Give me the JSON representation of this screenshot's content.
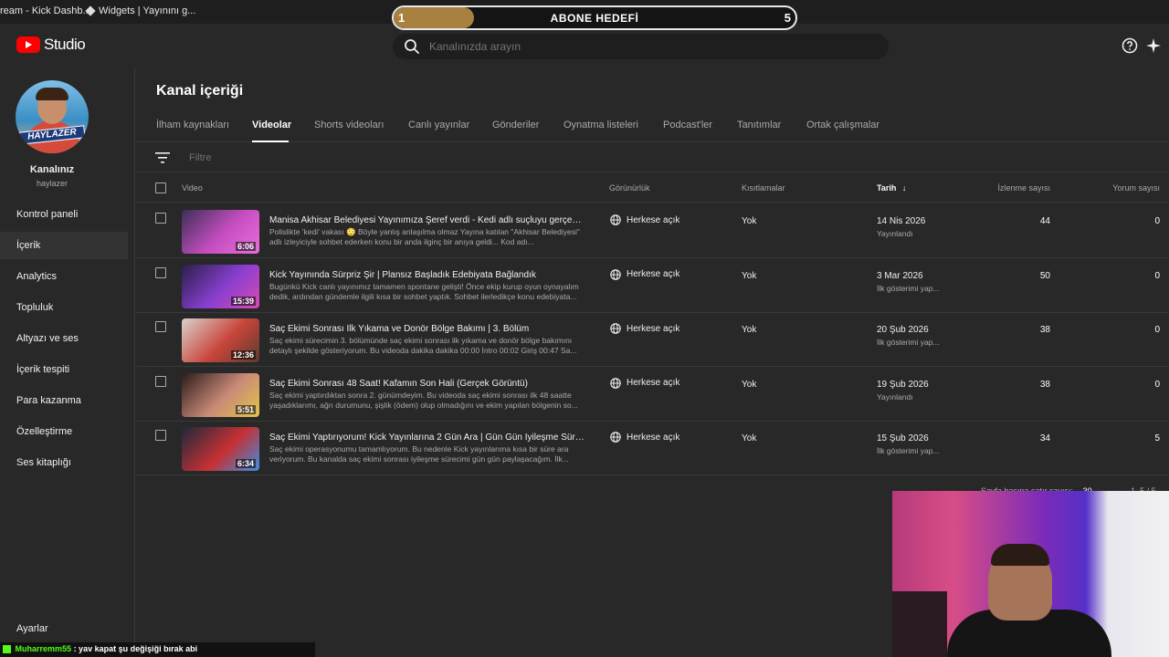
{
  "browser_tabs": [
    {
      "label": "ream - Kick Dashb...",
      "icon": "kick-icon"
    },
    {
      "label": "Widgets | Yayınını g...",
      "icon": "diamond-icon"
    }
  ],
  "goal_overlay": {
    "title": "ABONE HEDEFİ",
    "current": "1",
    "target": "5",
    "progress": 0.2,
    "fill_color": "#a8803f"
  },
  "header": {
    "logo_text": "Studio",
    "search_placeholder": "Kanalınızda arayın"
  },
  "sidebar": {
    "channel_name": "Kanalınız",
    "channel_handle": "haylazer",
    "avatar_text": "HAYLAZER",
    "items": [
      {
        "label": "Kontrol paneli",
        "active": false
      },
      {
        "label": "İçerik",
        "active": true
      },
      {
        "label": "Analytics",
        "active": false
      },
      {
        "label": "Topluluk",
        "active": false
      },
      {
        "label": "Altyazı ve ses",
        "active": false
      },
      {
        "label": "İçerik tespiti",
        "active": false
      },
      {
        "label": "Para kazanma",
        "active": false
      },
      {
        "label": "Özelleştirme",
        "active": false
      },
      {
        "label": "Ses kitaplığı",
        "active": false
      }
    ],
    "settings_label": "Ayarlar"
  },
  "main": {
    "title": "Kanal içeriği",
    "tabs": [
      {
        "label": "İlham kaynakları",
        "active": false
      },
      {
        "label": "Videolar",
        "active": true
      },
      {
        "label": "Shorts videoları",
        "active": false
      },
      {
        "label": "Canlı yayınlar",
        "active": false
      },
      {
        "label": "Gönderiler",
        "active": false
      },
      {
        "label": "Oynatma listeleri",
        "active": false
      },
      {
        "label": "Podcast'ler",
        "active": false
      },
      {
        "label": "Tanıtımlar",
        "active": false
      },
      {
        "label": "Ortak çalışmalar",
        "active": false
      }
    ],
    "filter_placeholder": "Filtre",
    "columns": {
      "video": "Video",
      "visibility": "Görünürlük",
      "restrictions": "Kısıtlamalar",
      "date": "Tarih",
      "views": "İzlenme sayısı",
      "comments": "Yorum sayısı"
    },
    "rows": [
      {
        "title": "Manisa Akhisar Belediyesi Yayınımıza Şeref verdi - Kedi adlı suçluyu gerçekten kedi...",
        "description": "Polislikte 'kedi' vakası 😳 Böyle yanlış anlaşılma olmaz Yayına katılan \"Akhisar Belediyesi\" adlı izleyiciyle sohbet ederken konu bir anda ilginç bir anıya geldi... Kod adı...",
        "duration": "6:06",
        "visibility": "Herkese açık",
        "restrictions": "Yok",
        "date": "14 Nis 2026",
        "status": "Yayınlandı",
        "views": "44",
        "comments": "0",
        "thumb_colors": [
          "#3c2f57",
          "#c74ec2",
          "#e86fd6"
        ]
      },
      {
        "title": "Kick Yayınında Sürpriz Şir | Plansız Başladık Edebiyata Bağlandık",
        "description": "Bugünkü Kick canlı yayınımız tamamen spontane gelişti! Önce ekip kurup oyun oynayalım dedik, ardından gündemle ilgili kısa bir sohbet yaptık. Sohbet ilerledikçe konu edebiyata...",
        "duration": "15:39",
        "visibility": "Herkese açık",
        "restrictions": "Yok",
        "date": "3 Mar 2026",
        "status": "İlk gösterimi yap...",
        "views": "50",
        "comments": "0",
        "thumb_colors": [
          "#2a1f4a",
          "#8b3fd1",
          "#d94bb0"
        ]
      },
      {
        "title": "Saç Ekimi Sonrası İlk Yıkama ve Donör Bölge Bakımı | 3. Bölüm",
        "description": "Saç ekimi sürecimin 3. bölümünde saç ekimi sonrası ilk yıkama ve donör bölge bakımını detaylı şekilde gösteriyorum. Bu videoda dakika dakika 00:00 İntro 00:02 Giriş 00:47 Sa...",
        "duration": "12:36",
        "visibility": "Herkese açık",
        "restrictions": "Yok",
        "date": "20 Şub 2026",
        "status": "İlk gösterimi yap...",
        "views": "38",
        "comments": "0",
        "thumb_colors": [
          "#d9d2cc",
          "#c9443b",
          "#5a3b2e"
        ]
      },
      {
        "title": "Saç Ekimi Sonrası 48 Saat! Kafamın Son Hali (Gerçek Görüntü)",
        "description": "Saç ekimi yaptırdıktan sonra 2. günümdeyim. Bu videoda saç ekimi sonrası ilk 48 saatte yaşadıklarımı, ağrı durumunu, şişlik (ödem) olup olmadığını ve ekim yapılan bölgenin so...",
        "duration": "5:51",
        "visibility": "Herkese açık",
        "restrictions": "Yok",
        "date": "19 Şub 2026",
        "status": "Yayınlandı",
        "views": "38",
        "comments": "0",
        "thumb_colors": [
          "#2b1c1a",
          "#c98a78",
          "#e3c34a"
        ]
      },
      {
        "title": "Saç Ekimi Yaptırıyorum! Kick Yayınlarına 2 Gün Ara | Gün Gün İyileşme Süreci Başlı...",
        "description": "Saç ekimi operasyonumu tamamlıyorum. Bu nedenle Kick yayınlarıma kısa bir süre ara veriyorum. Bu kanalda saç ekimi sonrası iyileşme sürecimi gün gün paylaşacağım. İlk...",
        "duration": "6:34",
        "visibility": "Herkese açık",
        "restrictions": "Yok",
        "date": "15 Şub 2026",
        "status": "İlk gösterimi yap...",
        "views": "34",
        "comments": "5",
        "thumb_colors": [
          "#1c2a3a",
          "#c63034",
          "#3d8fe0"
        ]
      }
    ],
    "pager": {
      "rows_label": "Sayfa başına satır sayısı:",
      "rows_value": "30",
      "range": "1–5 / 5"
    }
  },
  "chat": {
    "user": "Muharremm55",
    "message": ": yav kapat şu değişiği bırak abi",
    "user_color": "#53fc18"
  }
}
